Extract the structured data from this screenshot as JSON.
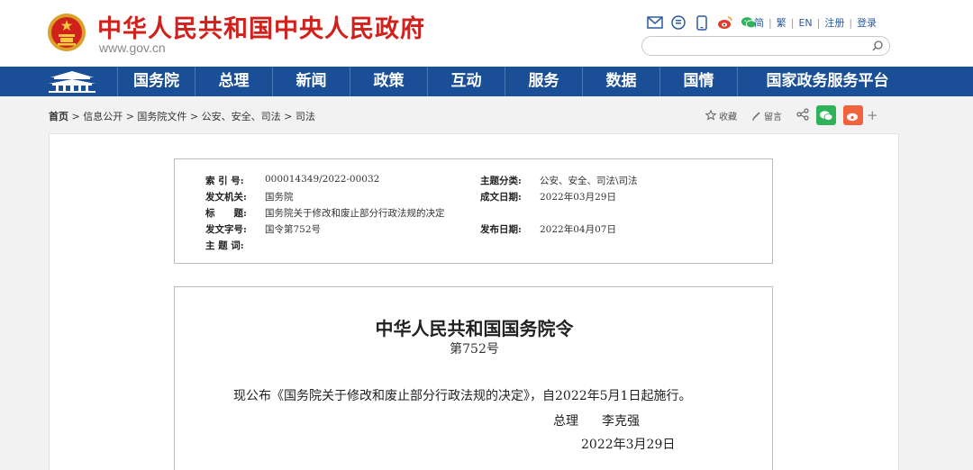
{
  "header": {
    "site_title": "中华人民共和国中央人民政府",
    "site_url": "www.gov.cn",
    "icons": [
      "mail-icon",
      "app-icon",
      "mobile-icon",
      "weibo-icon",
      "wechat-icon"
    ],
    "lang_simplified": "简",
    "lang_traditional": "繁",
    "lang_english": "EN",
    "register": "注册",
    "login": "登录",
    "search_placeholder": ""
  },
  "nav": {
    "items": [
      "国务院",
      "总理",
      "新闻",
      "政策",
      "互动",
      "服务",
      "数据",
      "国情",
      "国家政务服务平台"
    ]
  },
  "breadcrumb": {
    "home": "首页",
    "path": " > 信息公开 > 国务院文件 > 公安、安全、司法 > 司法"
  },
  "page_tools": {
    "favorite": "收藏",
    "comment": "留言"
  },
  "meta": {
    "index_label": "索 引 号:",
    "index_value": "000014349/2022-00032",
    "category_label": "主题分类:",
    "category_value": "公安、安全、司法\\司法",
    "issuer_label": "发文机关:",
    "issuer_value": "国务院",
    "created_label": "成文日期:",
    "created_value": "2022年03月29日",
    "title_label": "标　　题:",
    "title_value": "国务院关于修改和废止部分行政法规的决定",
    "docno_label": "发文字号:",
    "docno_value": "国令第752号",
    "published_label": "发布日期:",
    "published_value": "2022年04月07日",
    "keywords_label": "主 题 词:",
    "keywords_value": ""
  },
  "document": {
    "title": "中华人民共和国国务院令",
    "number": "第752号",
    "body": "现公布《国务院关于修改和废止部分行政法规的决定》，自2022年5月1日起施行。",
    "sign_role": "总理",
    "sign_name": "李克强",
    "date": "2022年3月29日"
  },
  "colors": {
    "brand_red": "#d0211c",
    "nav_blue": "#1a4f97",
    "wechat_green": "#2fb35a",
    "weibo_orange": "#f0633c"
  }
}
